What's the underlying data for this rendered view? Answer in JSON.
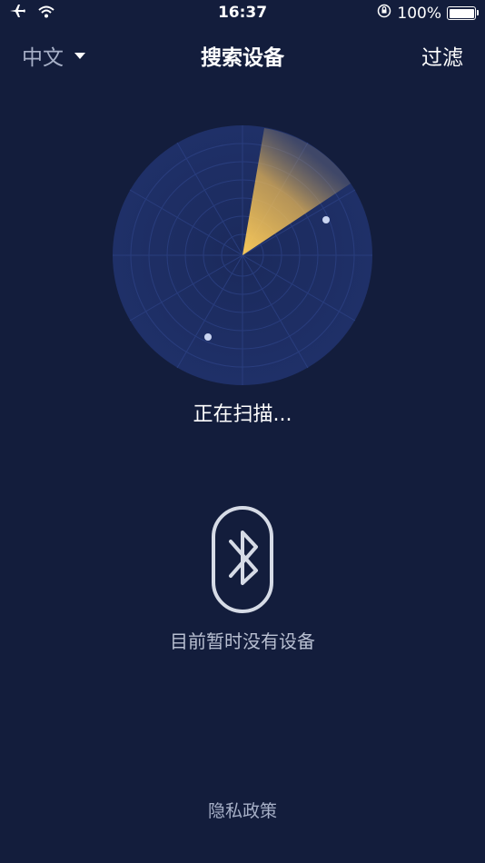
{
  "status_bar": {
    "time": "16:37",
    "battery": "100%",
    "icons": [
      "airplane-icon",
      "wifi-icon",
      "orientation-lock-icon",
      "battery-icon"
    ]
  },
  "nav": {
    "language": "中文",
    "title": "搜索设备",
    "filter": "过滤"
  },
  "radar": {
    "status": "正在扫描..."
  },
  "empty": {
    "message": "目前暂时没有设备",
    "icon": "bluetooth-icon"
  },
  "footer": {
    "privacy": "隐私政策"
  },
  "colors": {
    "background": "#131d3c",
    "radar_fill": "#1d2d63",
    "sweep": "#f5c35a",
    "dot": "#c9d4f0"
  }
}
